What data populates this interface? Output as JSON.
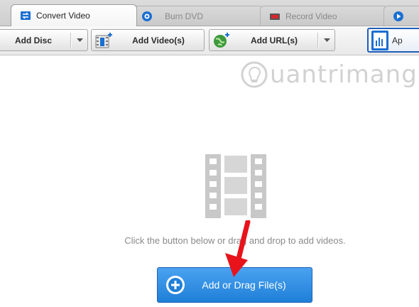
{
  "tabs": [
    {
      "label": "Convert Video",
      "icon": "convert-video-icon",
      "active": true
    },
    {
      "label": "Burn DVD",
      "icon": "disc-icon",
      "active": false
    },
    {
      "label": "Record Video",
      "icon": "record-icon",
      "active": false
    },
    {
      "label": "",
      "icon": "play-icon",
      "active": false
    }
  ],
  "toolbar": {
    "add_disc": "Add Disc",
    "add_videos": "Add Video(s)",
    "add_url": "Add URL(s)",
    "apply_label": "Ap"
  },
  "watermark": {
    "text": "uantrimang"
  },
  "main": {
    "hint": "Click the button below or drag and drop to add videos.",
    "add_button": "Add or Drag File(s)"
  },
  "colors": {
    "accent": "#1f7fd8",
    "arrow": "#e8131b",
    "tab_icon_blue": "#1a6fd1",
    "record_red": "#d9262a"
  }
}
